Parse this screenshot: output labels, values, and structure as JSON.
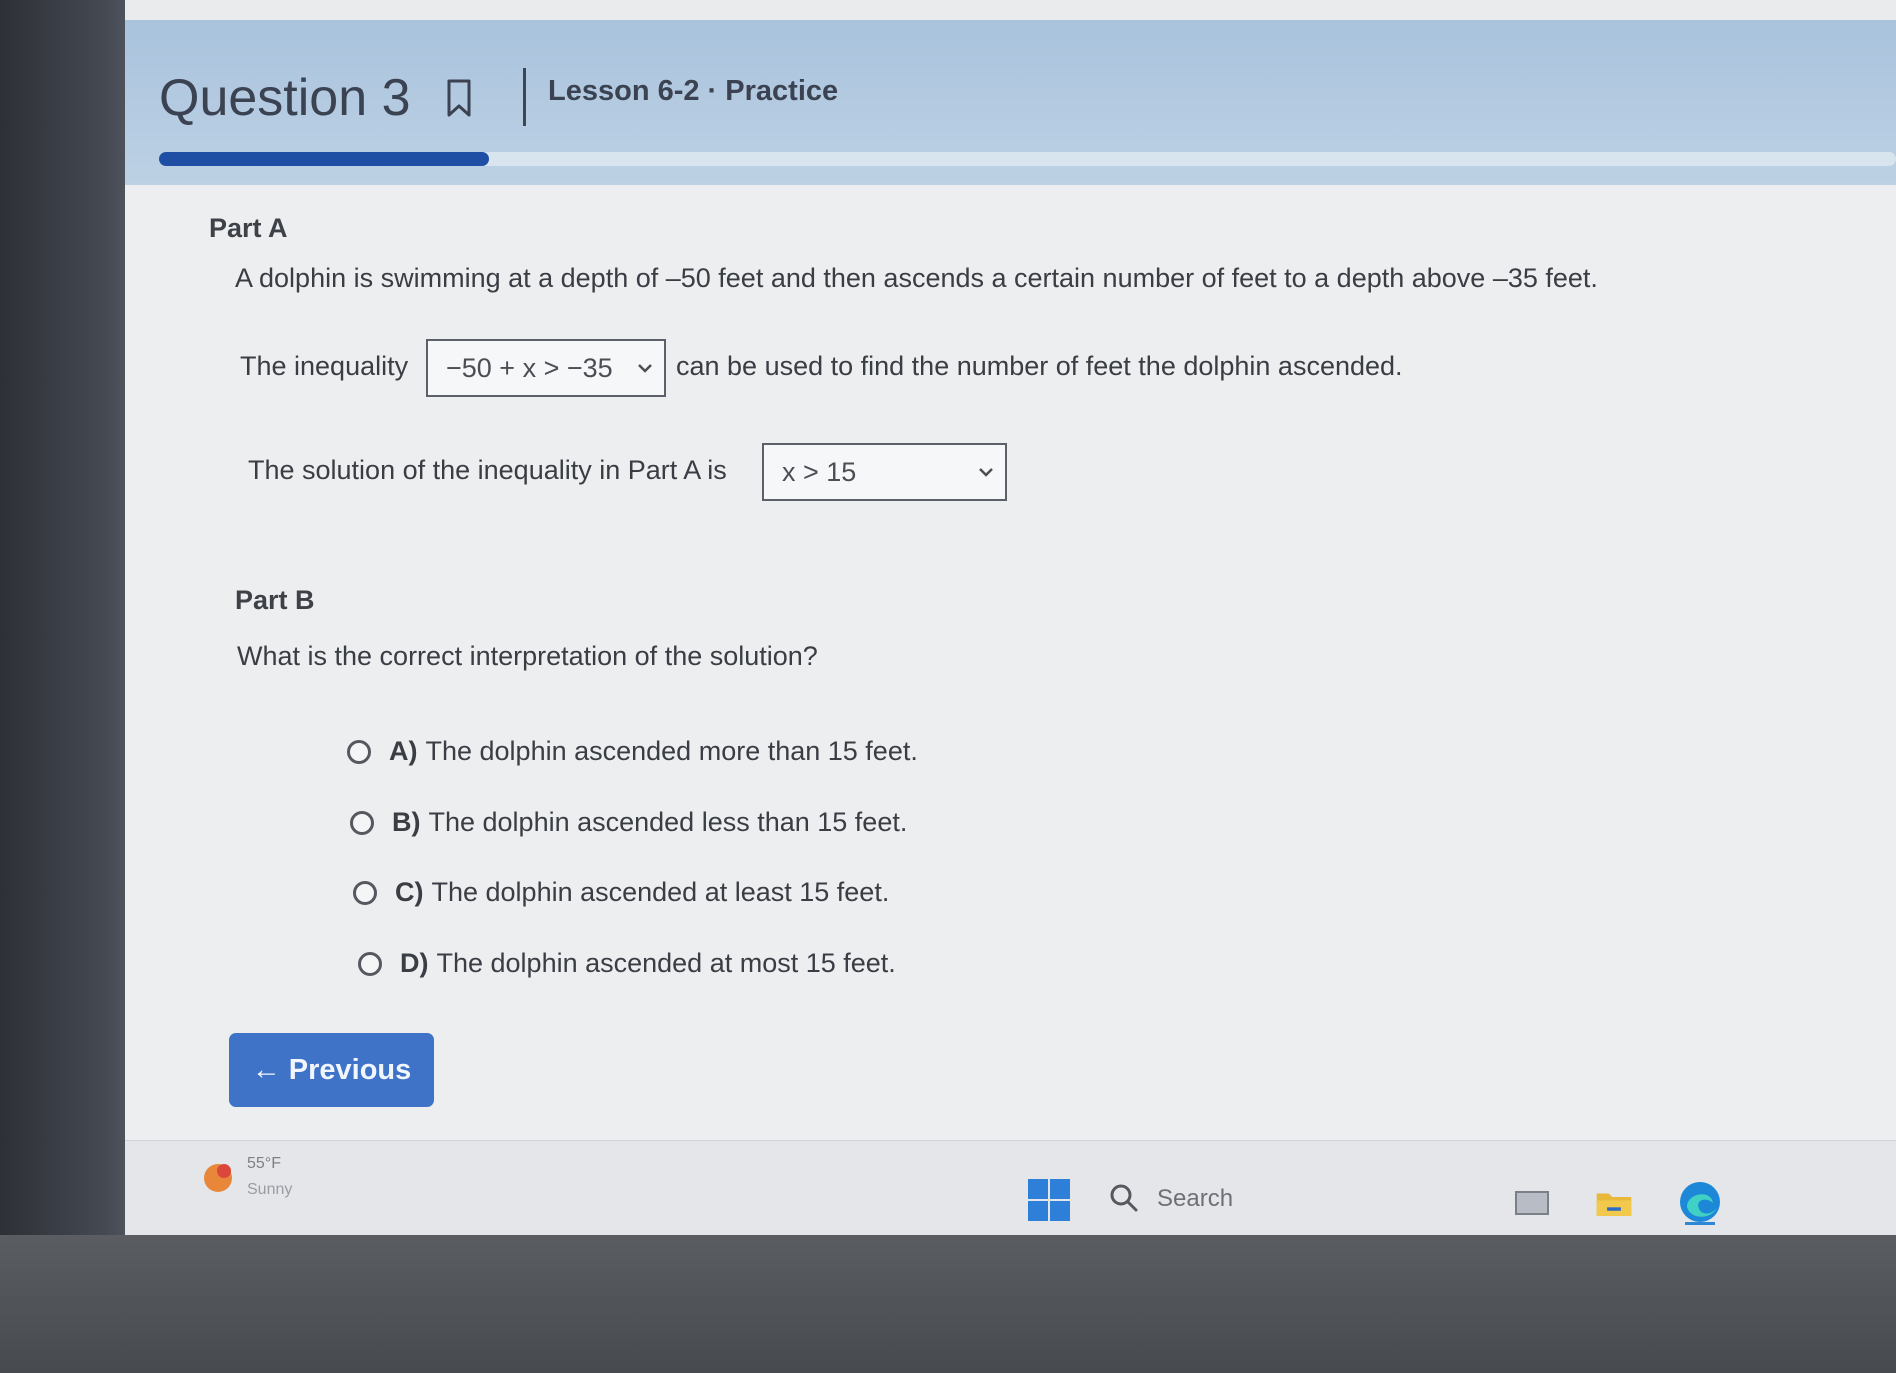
{
  "header": {
    "question_title": "Question 3",
    "lesson_title": "Lesson 6-2 · Practice",
    "progress": 0.19
  },
  "part_a": {
    "label": "Part A",
    "prompt": "A dolphin is swimming at a depth of –50 feet and then ascends a certain number of feet to a depth above –35 feet.",
    "inequality_prefix": "The inequality",
    "inequality_selected": "−50 + x > −35",
    "inequality_suffix": "can be used to find the number of feet the dolphin ascended.",
    "solution_prefix": "The solution of the inequality in Part A is",
    "solution_selected": "x > 15"
  },
  "part_b": {
    "label": "Part B",
    "question": "What is the correct interpretation of the solution?",
    "options": [
      {
        "letter": "A)",
        "text": "The dolphin ascended more than 15 feet."
      },
      {
        "letter": "B)",
        "text": "The dolphin ascended less than 15 feet."
      },
      {
        "letter": "C)",
        "text": "The dolphin ascended at least 15 feet."
      },
      {
        "letter": "D)",
        "text": "The dolphin ascended at most 15 feet."
      }
    ]
  },
  "nav": {
    "previous_label": "← Previous"
  },
  "taskbar": {
    "weather_temp": "55°F",
    "weather_condition": "Sunny",
    "search_label": "Search"
  },
  "colors": {
    "accent": "#1f4fa5",
    "button": "#3f73c8",
    "header_bg": "#b3cbe1"
  }
}
